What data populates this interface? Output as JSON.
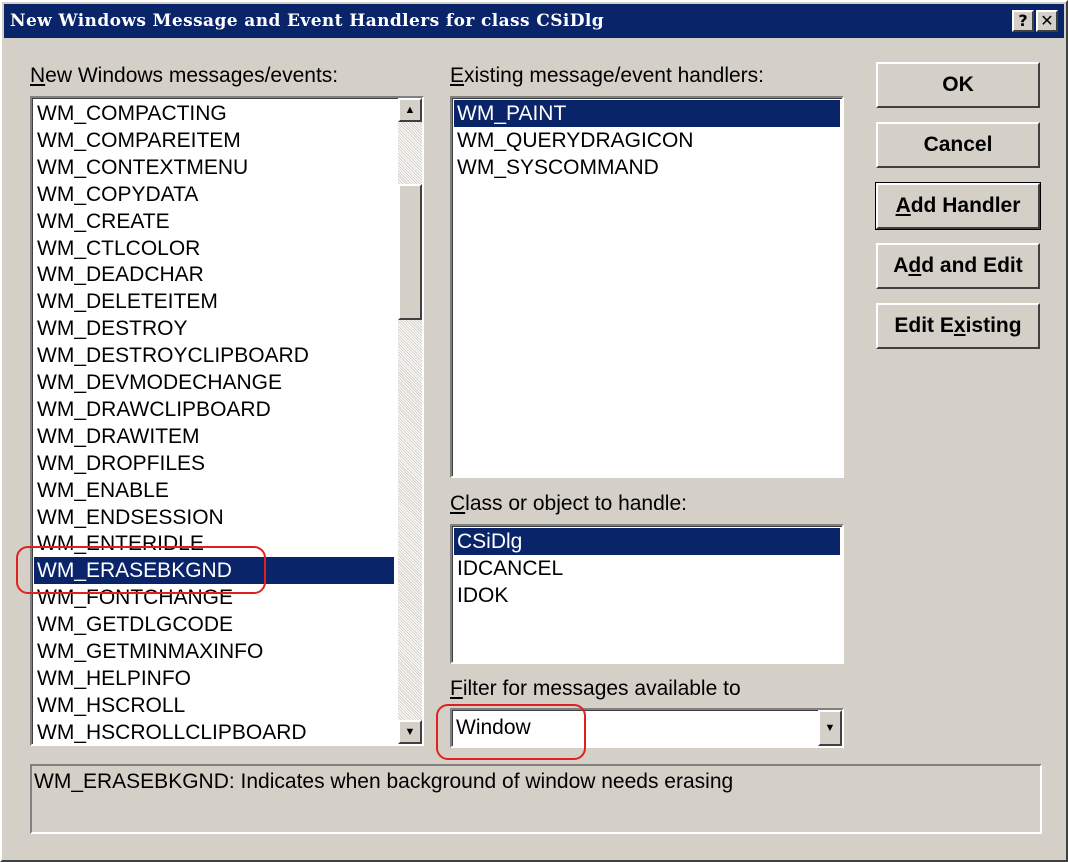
{
  "title": "New Windows Message and Event Handlers for class CSiDlg",
  "title_buttons": {
    "help": "?",
    "close": "✕"
  },
  "left_list": {
    "label_hot": "N",
    "label_rest": "ew Windows messages/events:",
    "items": [
      "WM_COMPACTING",
      "WM_COMPAREITEM",
      "WM_CONTEXTMENU",
      "WM_COPYDATA",
      "WM_CREATE",
      "WM_CTLCOLOR",
      "WM_DEADCHAR",
      "WM_DELETEITEM",
      "WM_DESTROY",
      "WM_DESTROYCLIPBOARD",
      "WM_DEVMODECHANGE",
      "WM_DRAWCLIPBOARD",
      "WM_DRAWITEM",
      "WM_DROPFILES",
      "WM_ENABLE",
      "WM_ENDSESSION",
      "WM_ENTERIDLE",
      "WM_ERASEBKGND",
      "WM_FONTCHANGE",
      "WM_GETDLGCODE",
      "WM_GETMINMAXINFO",
      "WM_HELPINFO",
      "WM_HSCROLL",
      "WM_HSCROLLCLIPBOARD"
    ],
    "selected_index": 17,
    "scroll_up_icon": "▲",
    "scroll_down_icon": "▼"
  },
  "existing_handlers": {
    "label_hot": "E",
    "label_rest": "xisting message/event handlers:",
    "items": [
      "WM_PAINT",
      "WM_QUERYDRAGICON",
      "WM_SYSCOMMAND"
    ],
    "selected_index": 0
  },
  "class_list": {
    "label_hot": "C",
    "label_rest": "lass or object to handle:",
    "items": [
      "CSiDlg",
      "IDCANCEL",
      "IDOK"
    ],
    "selected_index": 0
  },
  "filter": {
    "label_hot": "F",
    "label_rest": "ilter for messages available to",
    "value": "Window",
    "drop_icon": "▼"
  },
  "buttons": {
    "ok": "OK",
    "cancel": "Cancel",
    "add_handler_hot": "A",
    "add_handler_rest": "dd Handler",
    "add_edit_pre": "A",
    "add_edit_hot": "d",
    "add_edit_rest": "d and Edit",
    "edit_existing_pre": "Edit E",
    "edit_existing_hot": "x",
    "edit_existing_rest": "isting"
  },
  "description": "WM_ERASEBKGND:  Indicates when background of window needs erasing",
  "colors": {
    "titlebar": "#0a246a",
    "selection": "#0a246a",
    "face": "#d4d0c8",
    "annotation": "#e02020"
  }
}
